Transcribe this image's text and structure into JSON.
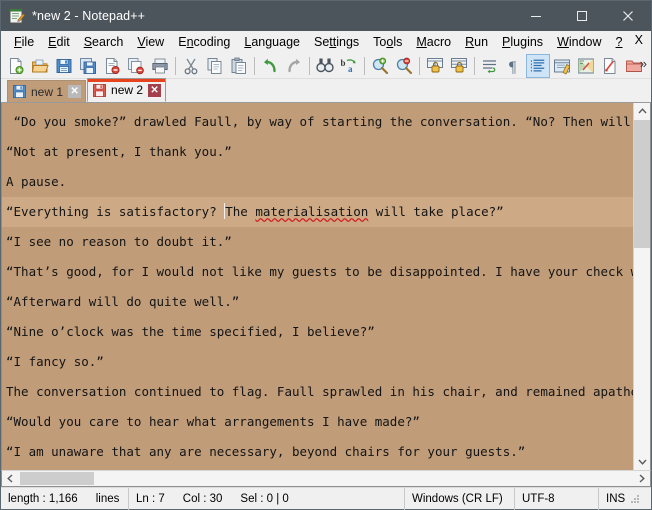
{
  "window": {
    "title": "*new 2 - Notepad++",
    "icon": "notepad-plus-plus-icon",
    "minimize_label": "minimize-icon",
    "maximize_label": "maximize-icon",
    "close_label": "close-icon"
  },
  "menubar": {
    "items": [
      {
        "label": "File",
        "accel": "F"
      },
      {
        "label": "Edit",
        "accel": "E"
      },
      {
        "label": "Search",
        "accel": "S"
      },
      {
        "label": "View",
        "accel": "V"
      },
      {
        "label": "Encoding",
        "accel": "n"
      },
      {
        "label": "Language",
        "accel": "L"
      },
      {
        "label": "Settings",
        "accel": "tt"
      },
      {
        "label": "Tools",
        "accel": "o"
      },
      {
        "label": "Macro",
        "accel": "M"
      },
      {
        "label": "Run",
        "accel": "R"
      },
      {
        "label": "Plugins",
        "accel": "P"
      },
      {
        "label": "Window",
        "accel": "W"
      },
      {
        "label": "?",
        "accel": "?"
      }
    ],
    "close_document": "X"
  },
  "toolbar": {
    "overflow": "»",
    "buttons": [
      {
        "name": "new-file-icon",
        "title": "New"
      },
      {
        "name": "open-file-icon",
        "title": "Open"
      },
      {
        "name": "save-icon",
        "title": "Save"
      },
      {
        "name": "save-all-icon",
        "title": "Save All"
      },
      {
        "name": "close-document-icon",
        "title": "Close"
      },
      {
        "name": "close-all-documents-icon",
        "title": "Close All"
      },
      {
        "name": "print-icon",
        "title": "Print"
      },
      {
        "name": "cut-icon",
        "title": "Cut"
      },
      {
        "name": "copy-icon",
        "title": "Copy"
      },
      {
        "name": "paste-icon",
        "title": "Paste"
      },
      {
        "name": "undo-icon",
        "title": "Undo"
      },
      {
        "name": "redo-icon",
        "title": "Redo"
      },
      {
        "name": "find-icon",
        "title": "Find"
      },
      {
        "name": "replace-icon",
        "title": "Replace"
      },
      {
        "name": "zoom-in-icon",
        "title": "Zoom In"
      },
      {
        "name": "zoom-out-icon",
        "title": "Zoom Out"
      },
      {
        "name": "sync-vertical-scrolling-icon",
        "title": "Synchronize Vertical Scrolling"
      },
      {
        "name": "sync-horizontal-scrolling-icon",
        "title": "Synchronize Horizontal Scrolling"
      },
      {
        "name": "word-wrap-icon",
        "title": "Word wrap"
      },
      {
        "name": "show-all-characters-icon",
        "title": "Show All Characters"
      },
      {
        "name": "indent-guideline-icon",
        "title": "Show Indent Guide"
      },
      {
        "name": "user-defined-dialog-icon",
        "title": "User Defined Dialogue"
      },
      {
        "name": "document-map-icon",
        "title": "Document Map"
      },
      {
        "name": "function-list-icon",
        "title": "Function List"
      },
      {
        "name": "folder-as-workspace-icon",
        "title": "Folder as Workspace"
      }
    ]
  },
  "tabs": [
    {
      "label": "new 1",
      "active": false,
      "save_icon": "save-icon-blue",
      "close_icon": "tab-close-icon"
    },
    {
      "label": "new 2",
      "active": true,
      "save_icon": "save-icon-red",
      "close_icon": "tab-close-icon"
    }
  ],
  "editor": {
    "lines": [
      {
        "text": " “Do you smoke?” drawled Faull, by way of starting the conversation. “No? Then will you t",
        "current": false
      },
      {
        "text": "“Not at present, I thank you.”",
        "current": false
      },
      {
        "text": "A pause.",
        "current": false
      },
      {
        "text_before": "“Everything is satisfactory? ",
        "text_spell": "materialisation",
        "text_mid": "The ",
        "text_after": " will take place?”",
        "current": true,
        "has_caret": true
      },
      {
        "text": "“I see no reason to doubt it.”",
        "current": false
      },
      {
        "text": "“That’s good, for I would not like my guests to be disappointed. I have your check writte",
        "current": false
      },
      {
        "text": "“Afterward will do quite well.”",
        "current": false
      },
      {
        "text": "“Nine o’clock was the time specified, I believe?”",
        "current": false
      },
      {
        "text": "“I fancy so.”",
        "current": false
      },
      {
        "text": "The conversation continued to flag. Faull sprawled in his chair, and remained apathetic.",
        "current": false
      },
      {
        "text": "“Would you care to hear what arrangements I have made?”",
        "current": false
      },
      {
        "text": "“I am unaware that any are necessary, beyond chairs for your guests.”",
        "current": false
      }
    ],
    "background_color": "#c09c79",
    "current_line_color": "#cdaa85",
    "text_color": "#141414",
    "spell_error_color": "#d21f1f"
  },
  "statusbar": {
    "length_label": "length : 1,166",
    "lines_label": "lines",
    "line_label": "Ln : 7",
    "col_label": "Col : 30",
    "sel_label": "Sel : 0 | 0",
    "eol_label": "Windows (CR LF)",
    "encoding_label": "UTF-8",
    "mode_label": "INS"
  }
}
